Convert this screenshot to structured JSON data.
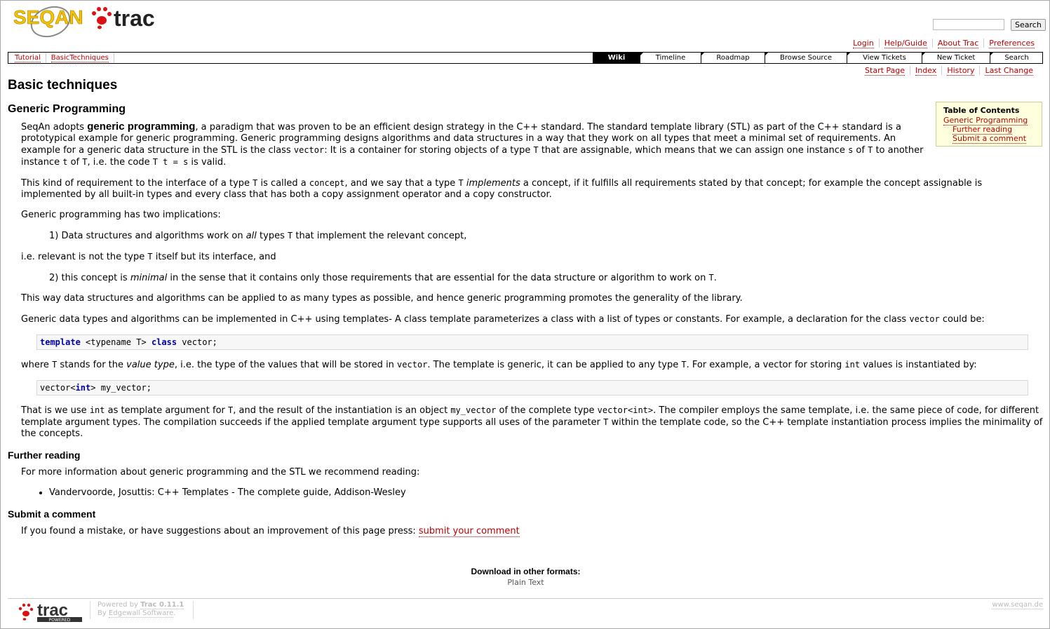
{
  "banner": {
    "logo_left": "SEQAN",
    "logo_right": "trac",
    "search_button": "Search"
  },
  "metanav": [
    "Login",
    "Help/Guide",
    "About Trac",
    "Preferences"
  ],
  "breadcrumbs": [
    "Tutorial",
    "BasicTechniques"
  ],
  "mainnav": [
    {
      "label": "Wiki",
      "active": true
    },
    {
      "label": "Timeline"
    },
    {
      "label": "Roadmap"
    },
    {
      "label": "Browse Source"
    },
    {
      "label": "View Tickets"
    },
    {
      "label": "New Ticket"
    },
    {
      "label": "Search"
    }
  ],
  "ctxnav": [
    "Start Page",
    "Index",
    "History",
    "Last Change"
  ],
  "page": {
    "title": "Basic techniques",
    "h2": "Generic Programming",
    "p1": {
      "a": "SeqAn adopts ",
      "b": "generic programming",
      "c": ", a paradigm that was proven to be an efficient design strategy in the C++ standard. The standard template library (STL) as part of the C++ standard is a prototypical example for generic programming. Generic programming designs algorithms and data structures in a way that they work on all types that meet a minimal set of requirements. An example for a generic data structure in the STL is the class ",
      "d": "vector",
      "e": ": It is a container for storing objects of a type ",
      "f": "T",
      "g": " that are assignable, which means that we can assign one instance ",
      "h": "s",
      "i": " of ",
      "j": "T",
      "k": " to another instance ",
      "l": "t",
      "m": " of ",
      "n": "T",
      "o": ", i.e. the code ",
      "p": "T t = s",
      "q": " is valid."
    },
    "p2": {
      "a": "This kind of requirement to the interface of a type ",
      "b": "T",
      "c": " is called a ",
      "d": "concept",
      "e": ", and we say that a type ",
      "f": "T",
      "g": "implements",
      "h": " a concept, if it fulfills all requirements stated by that concept; for example the concept assignable is implemented by all built-in types and every class that has both a copy assignment operator and a copy constructor."
    },
    "p3": "Generic programming has two implications:",
    "li1": {
      "a": "1) Data structures and algorithms work on ",
      "b": "all",
      "c": " types ",
      "d": "T",
      "e": " that implement the relevant concept,"
    },
    "p4": {
      "a": "i.e. relevant is not the type ",
      "b": "T",
      "c": " itself but its interface, and"
    },
    "li2": {
      "a": "2) this concept is ",
      "b": "minimal",
      "c": " in the sense that it contains only those requirements that are essential for the data structure or algorithm to work on ",
      "d": "T",
      "e": "."
    },
    "p5": "This way data structures and algorithms can be applied to as many types as possible, and hence generic programming promotes the generality of the library.",
    "p6": {
      "a": "Generic data types and algorithms can be implemented in C++ using templates- A class template parameterizes a class with a list of types or constants. For example, a declaration for the class ",
      "b": "vector",
      "c": " could be:"
    },
    "code1": {
      "kw1": "template",
      "mid": " <typename T> ",
      "kw2": "class",
      "end": " vector;"
    },
    "p7": {
      "a": "where ",
      "b": "T",
      "c": " stands for the ",
      "d": "value type",
      "e": ", i.e. the type of the values that will be stored in ",
      "f": "vector",
      "g": ". The template is generic, it can be applied to any type ",
      "h": "T",
      "i": ". For example, a vector for storing ",
      "j": "int",
      "k": " values is instantiated by:"
    },
    "code2": {
      "a": "vector<",
      "kw": "int",
      "b": "> my_vector;"
    },
    "p8": {
      "a": "That is we use ",
      "b": "int",
      "c": " as template argument for ",
      "d": "T",
      "e": ", and the result of the instantiation is an object ",
      "f": "my_vector",
      "g": " of the complete type ",
      "h": "vector<int>",
      "i": ". The compiler employs the same template, i.e. the same piece of code, for different template argument types. The compilation succeeds if the applied template argument type supports all uses of the parameter ",
      "j": "T",
      "k": " within the template code, so the C++ template instantiation process implies the minimality of the concepts."
    },
    "h3_further": "Further reading",
    "p9": "For more information about generic programming and the STL we recommend reading:",
    "bib": [
      "Vandervoorde, Josuttis: C++ Templates - The complete guide, Addison-Wesley"
    ],
    "h3_comment": "Submit a comment",
    "p10": "If you found a mistake, or have suggestions about an improvement of this page press: ",
    "comment_link": "submit your comment"
  },
  "toc": {
    "title": "Table of Contents",
    "items": [
      "Generic Programming",
      "Further reading",
      "Submit a comment"
    ]
  },
  "altlinks": {
    "heading": "Download in other formats:",
    "formats": [
      "Plain Text"
    ]
  },
  "footer": {
    "powered_prefix": "Powered by ",
    "trac_version": "Trac 0.11.1",
    "by_prefix": "By ",
    "company": "Edgewall Software",
    "by_suffix": ".",
    "site": "www.seqan.de",
    "badge": "POWERED"
  }
}
